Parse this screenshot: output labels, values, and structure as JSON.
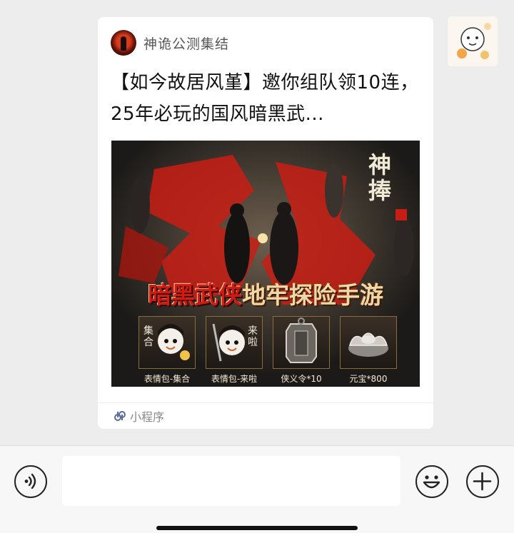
{
  "card": {
    "app_name": "神诡公测集结",
    "title": "【如今故居风堇】邀你组队领10连，25年必玩的国风暗黑武...",
    "banner": {
      "headline_red": "暗黑武侠",
      "headline_gold": "地牢探险手游",
      "logo": "神捧",
      "rewards": [
        {
          "label": "表情包-集合",
          "icon": "sticker-gather-icon"
        },
        {
          "label": "表情包-来啦",
          "icon": "sticker-coming-icon"
        },
        {
          "label": "侠义令*10",
          "icon": "token-icon"
        },
        {
          "label": "元宝*800",
          "icon": "ingot-icon"
        }
      ]
    },
    "footer_label": "小程序",
    "footer_icon": "mini-program-icon"
  },
  "input_bar": {
    "voice_icon": "voice-icon",
    "input_value": "",
    "emoji_icon": "emoji-icon",
    "plus_icon": "plus-icon"
  },
  "colors": {
    "chat_bg": "#ededed",
    "card_bg": "#ffffff",
    "accent_red": "#d21a12",
    "mini_program_blue": "#576b95"
  }
}
